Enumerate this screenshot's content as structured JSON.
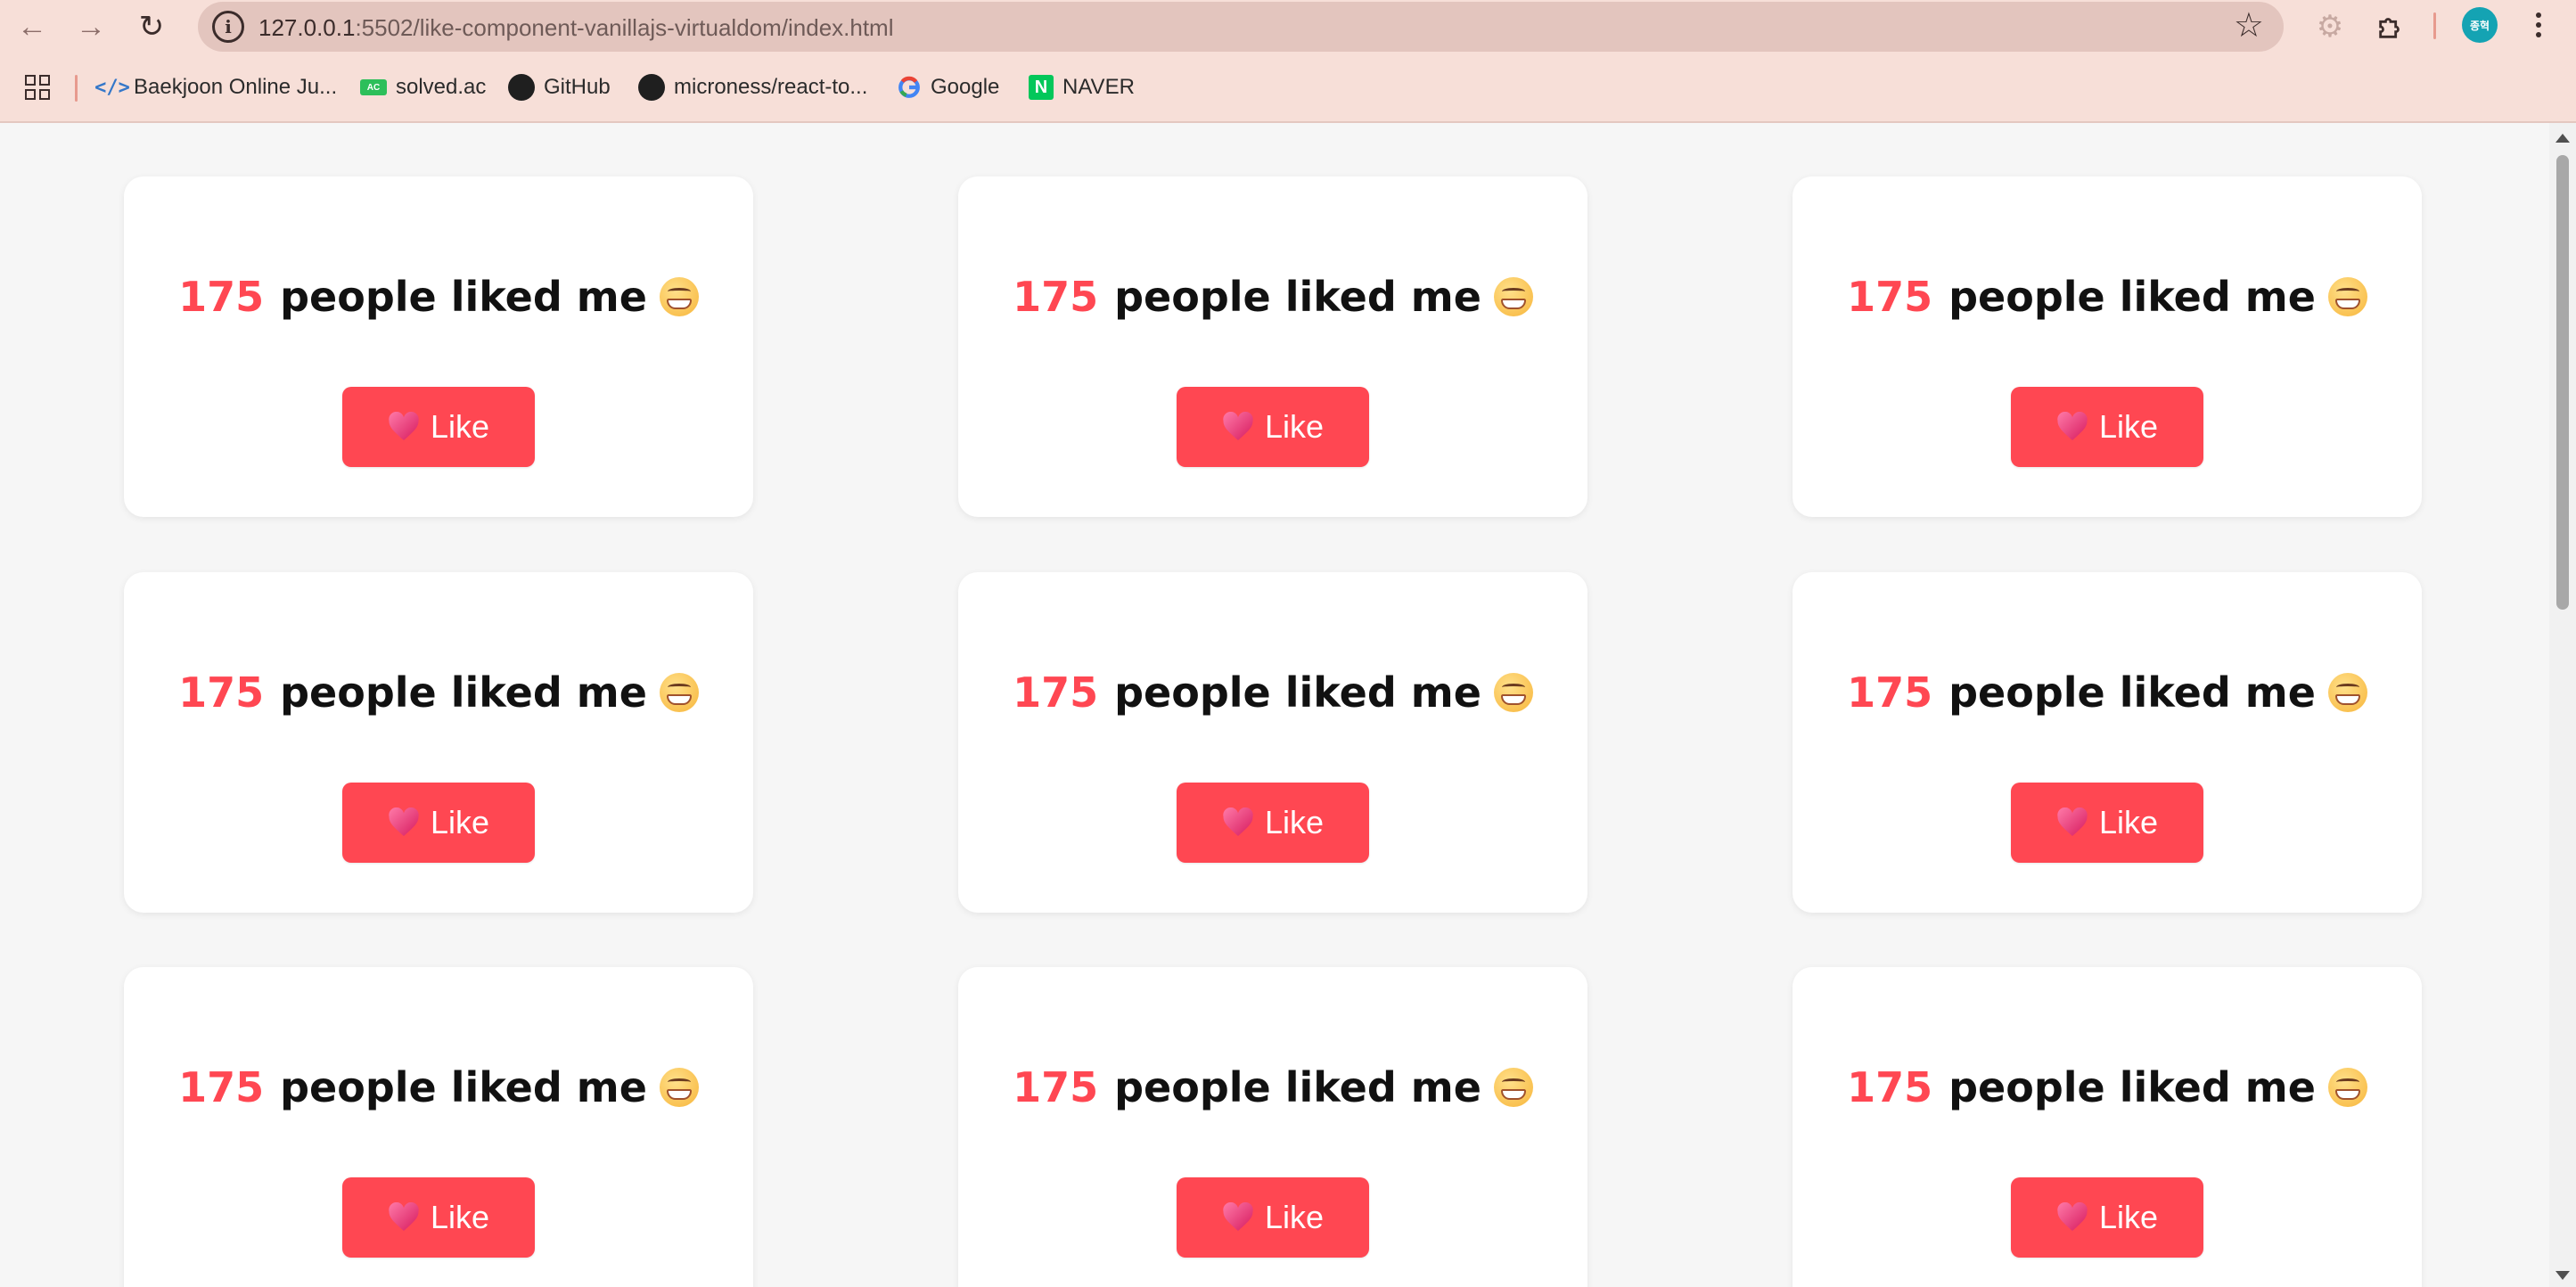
{
  "browser": {
    "url_host": "127.0.0.1",
    "url_path": ":5502/like-component-vanillajs-virtualdom/index.html",
    "profile_initials": "종혁",
    "bookmarks": [
      {
        "label": "Baekjoon Online Ju...",
        "icon": "code-brackets-icon"
      },
      {
        "label": "solved.ac",
        "icon": "solved-ac-icon"
      },
      {
        "label": "GitHub",
        "icon": "github-icon"
      },
      {
        "label": "microness/react-to...",
        "icon": "github-icon"
      },
      {
        "label": "Google",
        "icon": "google-icon"
      },
      {
        "label": "NAVER",
        "icon": "naver-icon"
      }
    ]
  },
  "cards": [
    {
      "count": "175",
      "text": "people liked me",
      "button_label": "Like"
    },
    {
      "count": "175",
      "text": "people liked me",
      "button_label": "Like"
    },
    {
      "count": "175",
      "text": "people liked me",
      "button_label": "Like"
    },
    {
      "count": "175",
      "text": "people liked me",
      "button_label": "Like"
    },
    {
      "count": "175",
      "text": "people liked me",
      "button_label": "Like"
    },
    {
      "count": "175",
      "text": "people liked me",
      "button_label": "Like"
    },
    {
      "count": "175",
      "text": "people liked me",
      "button_label": "Like"
    },
    {
      "count": "175",
      "text": "people liked me",
      "button_label": "Like"
    },
    {
      "count": "175",
      "text": "people liked me",
      "button_label": "Like"
    }
  ],
  "colors": {
    "accent": "#ff4752",
    "chrome": "#f7dfd8",
    "page_background": "#f6f6f6"
  }
}
